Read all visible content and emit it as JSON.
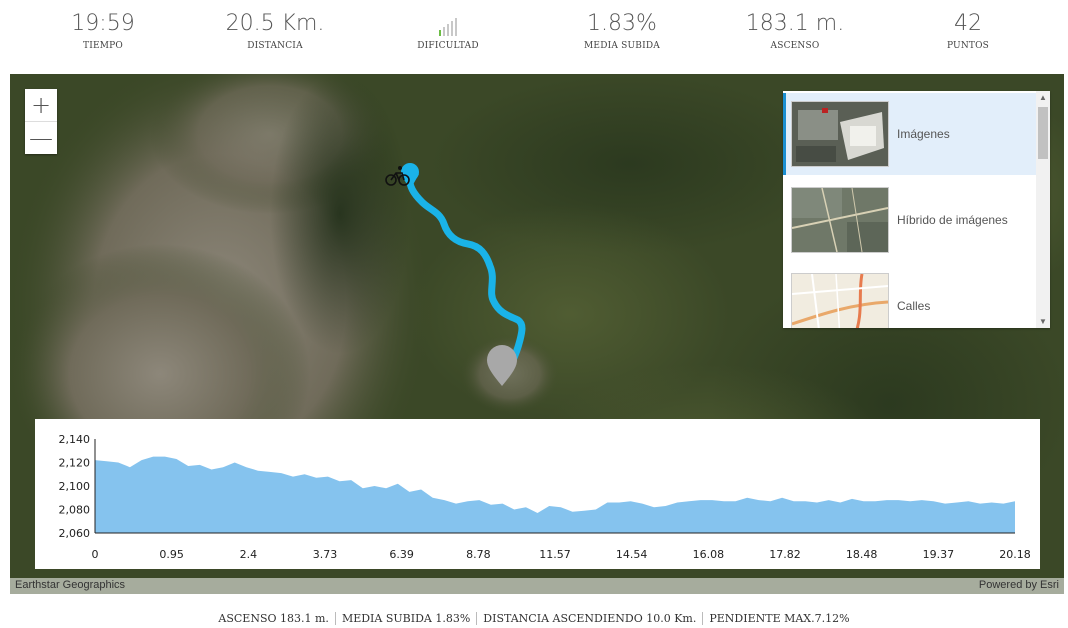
{
  "stats": [
    {
      "value": "19:59",
      "label": "TIEMPO"
    },
    {
      "value": "20.5 Km.",
      "label": "DISTANCIA"
    },
    {
      "value": "",
      "label": "DIFICULTAD",
      "difficulty_level": 1,
      "difficulty_max": 5
    },
    {
      "value": "1.83%",
      "label": "MEDIA SUBIDA"
    },
    {
      "value": "183.1 m.",
      "label": "ASCENSO"
    },
    {
      "value": "42",
      "label": "PUNTOS"
    }
  ],
  "map": {
    "zoom_in": "+",
    "zoom_out": "—",
    "route_color": "#1ab3e8",
    "start_marker_color": "#1ab3e8",
    "end_marker_color": "#a8a8a8",
    "attribution_left": "Earthstar Geographics",
    "attribution_right": "Powered by Esri"
  },
  "basemap_gallery": {
    "items": [
      {
        "label": "Imágenes",
        "selected": true
      },
      {
        "label": "Híbrido de imágenes",
        "selected": false
      },
      {
        "label": "Calles",
        "selected": false
      }
    ]
  },
  "chart_data": {
    "type": "area",
    "title": "",
    "xlabel": "",
    "ylabel": "",
    "x_tick_labels": [
      "0",
      "0.95",
      "2.4",
      "3.73",
      "6.39",
      "8.78",
      "11.57",
      "14.54",
      "16.08",
      "17.82",
      "18.48",
      "19.37",
      "20.18"
    ],
    "y_tick_labels": [
      "2,140",
      "2,120",
      "2,100",
      "2,080",
      "2,060"
    ],
    "ylim": [
      2060,
      2140
    ],
    "series": [
      {
        "fill": "#85c3ee",
        "values": [
          2122,
          2121,
          2120,
          2116,
          2122,
          2125,
          2125,
          2123,
          2117,
          2118,
          2114,
          2116,
          2120,
          2116,
          2113,
          2112,
          2111,
          2108,
          2110,
          2107,
          2108,
          2104,
          2105,
          2098,
          2100,
          2098,
          2102,
          2095,
          2097,
          2090,
          2088,
          2085,
          2087,
          2088,
          2084,
          2085,
          2080,
          2082,
          2077,
          2083,
          2082,
          2078,
          2079,
          2080,
          2086,
          2086,
          2087,
          2085,
          2082,
          2083,
          2086,
          2087,
          2088,
          2088,
          2087,
          2087,
          2090,
          2088,
          2087,
          2090,
          2087,
          2087,
          2086,
          2088,
          2086,
          2089,
          2087,
          2087,
          2088,
          2088,
          2087,
          2088,
          2087,
          2085,
          2086,
          2087,
          2085,
          2086,
          2085,
          2087
        ]
      }
    ]
  },
  "footer": [
    {
      "label": "ASCENSO",
      "value": "183.1 m."
    },
    {
      "label": "MEDIA SUBIDA",
      "value": "1.83%"
    },
    {
      "label": "DISTANCIA ASCENDIENDO",
      "value": "10.0 Km."
    },
    {
      "label": "PENDIENTE MAX.",
      "value": "7.12%"
    }
  ]
}
